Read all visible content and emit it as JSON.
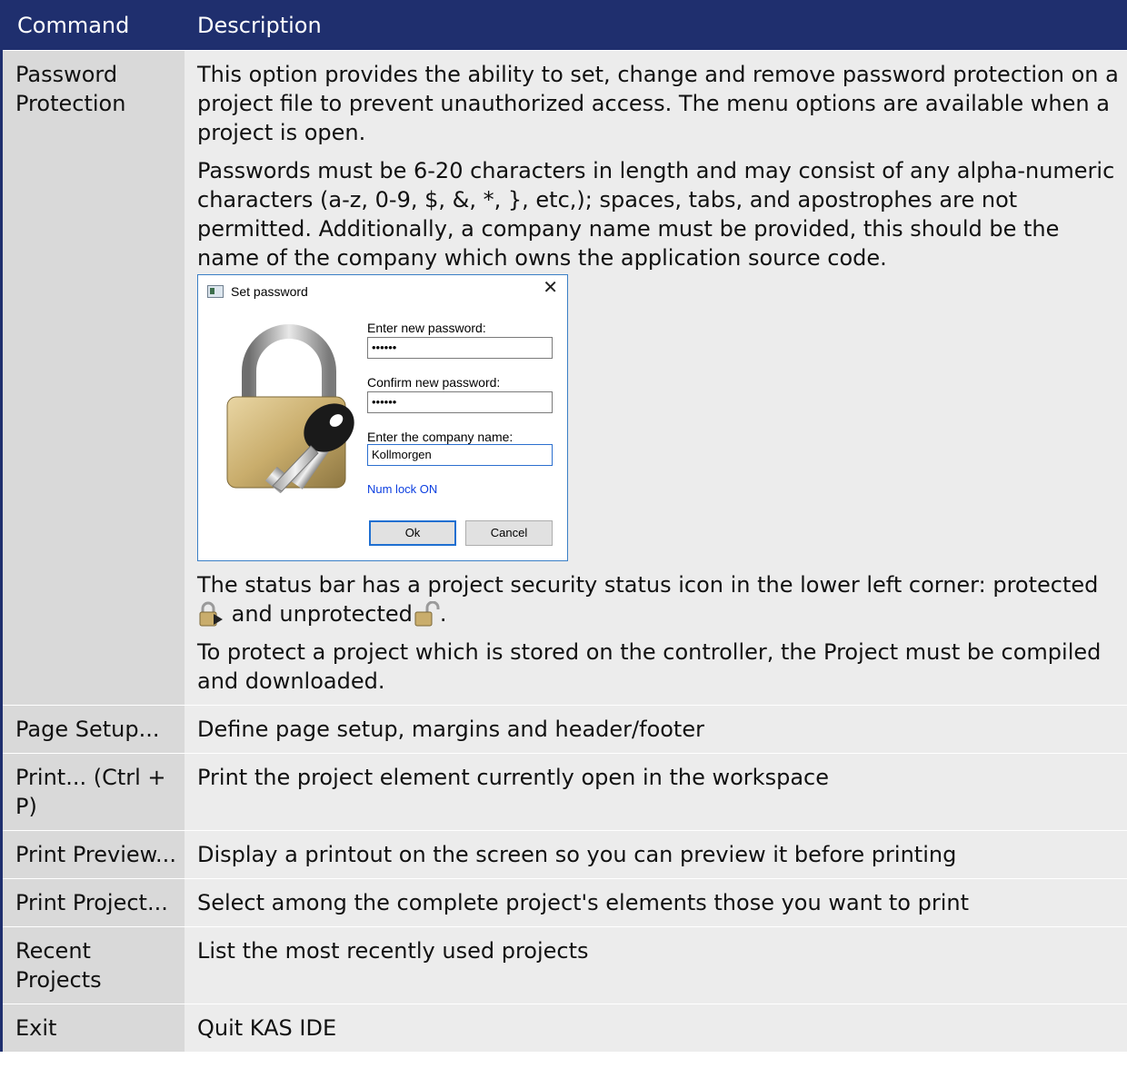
{
  "header": {
    "command": "Command",
    "description": "Description"
  },
  "password_row": {
    "command": "Password Protection",
    "para1": "This option provides the ability to set, change and remove password protection on a project file to prevent unauthorized access. The menu options are available when a project is open.",
    "para2": "Passwords must be 6-20 characters in length and may consist of any alpha-numeric characters (a-z, 0-9, $, &, *, }, etc,); spaces, tabs, and apostrophes are not permitted. Additionally, a company name must be provided, this should be the name of the company which owns the application source code.",
    "para3_part1": "The status bar has a project security status icon in the lower left corner: protected",
    "para3_part2": " and unprotected",
    "para3_part3": ".",
    "para4": "To protect a project which is stored on the controller, the Project must be compiled and downloaded."
  },
  "dialog": {
    "title": "Set password",
    "new_password_label": "Enter new password:",
    "new_password_value": "••••••",
    "confirm_password_label": "Confirm new password:",
    "confirm_password_value": "••••••",
    "company_label": "Enter the company name:",
    "company_value": "Kollmorgen",
    "numlock_status": "Num lock ON",
    "ok_label": "Ok",
    "cancel_label": "Cancel"
  },
  "rows": [
    {
      "command": "Page Setup...",
      "description": "Define page setup, margins and header/footer"
    },
    {
      "command": "Print... (Ctrl + P)",
      "description": "Print the project element currently open in the workspace"
    },
    {
      "command": "Print Preview...",
      "description": "Display a printout on the screen so you can preview it before printing"
    },
    {
      "command": "Print Project...",
      "description": "Select among the complete project's elements those you want to print"
    },
    {
      "command": "Recent Projects",
      "description": "List the most recently used projects"
    },
    {
      "command": "Exit",
      "description": "Quit KAS IDE"
    }
  ],
  "colors": {
    "header_bg": "#1f2f6e",
    "command_bg": "#d9d9d9",
    "description_bg": "#ececec",
    "link_blue": "#0b3ee0"
  },
  "icons": [
    "lock-icon",
    "protected-lock-icon",
    "unprotected-lock-icon",
    "close-icon",
    "app-icon"
  ]
}
